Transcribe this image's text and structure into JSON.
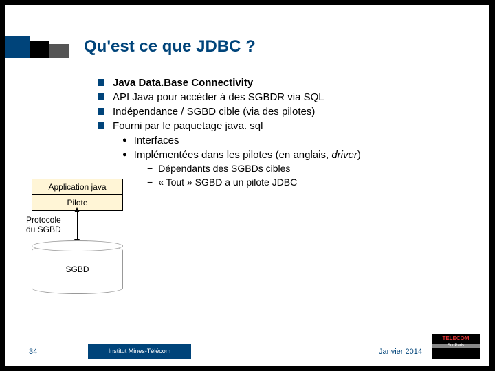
{
  "title": "Qu'est ce que JDBC ?",
  "bullets": {
    "b1": "Java Data.Base Connectivity",
    "b2": "API Java pour accéder à des SGBDR via SQL",
    "b3": "Indépendance / SGBD cible (via des pilotes)",
    "b4": "Fourni par le paquetage java. sql",
    "s1": "Interfaces",
    "s2a": "Implémentées dans les pilotes (en anglais, ",
    "s2b": "driver",
    "s2c": ")",
    "d1": "Dépendants des SGBDs cibles",
    "d2": "« Tout » SGBD a un pilote JDBC"
  },
  "diagram": {
    "app": "Application java",
    "pilot": "Pilote",
    "proto_l1": "Protocole",
    "proto_l2": "du SGBD",
    "db": "SGBD"
  },
  "footer": {
    "page": "34",
    "institution": "Institut Mines-Télécom",
    "date": "Janvier 2014",
    "brand1": "TELECOM",
    "brand2": "SudParis"
  }
}
